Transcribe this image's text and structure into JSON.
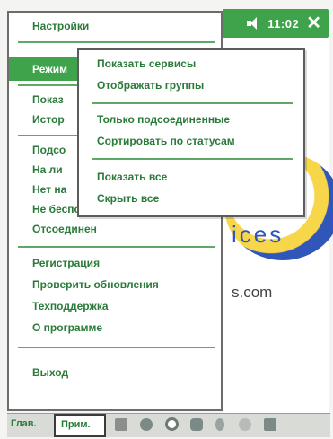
{
  "status_bar": {
    "time": "11:02",
    "volume_icon": "speaker-icon",
    "close_label": "✕"
  },
  "background": {
    "logo_text": "ices",
    "url_text": "s.com"
  },
  "main_menu": {
    "items": [
      {
        "label": "Настройки"
      },
      {
        "label": "Режим"
      },
      {
        "label": "Показ"
      },
      {
        "label": "Истор"
      },
      {
        "label": "Подсо"
      },
      {
        "label": "На ли"
      },
      {
        "label": "Нет на"
      },
      {
        "label": "Не беспокоить"
      },
      {
        "label": "Отсоединен"
      },
      {
        "label": "Регистрация"
      },
      {
        "label": "Проверить обновления"
      },
      {
        "label": "Техподдержка"
      },
      {
        "label": "О программе"
      },
      {
        "label": "Выход"
      }
    ]
  },
  "submenu": {
    "items": [
      {
        "label": "Показать сервисы"
      },
      {
        "label": "Отображать группы"
      },
      {
        "label": "Только подсоединенные"
      },
      {
        "label": "Сортировать по статусам"
      },
      {
        "label": "Показать все"
      },
      {
        "label": "Скрыть все"
      }
    ]
  },
  "taskbar": {
    "left_label": "Глав.",
    "active_label": "Прим.",
    "icons": [
      "tool-icon",
      "globe-icon",
      "record-icon",
      "chat-icon",
      "bulb-icon",
      "circle-icon",
      "block-icon"
    ]
  },
  "colors": {
    "accent": "#3ea34a",
    "menu_text": "#2a7a3a"
  }
}
